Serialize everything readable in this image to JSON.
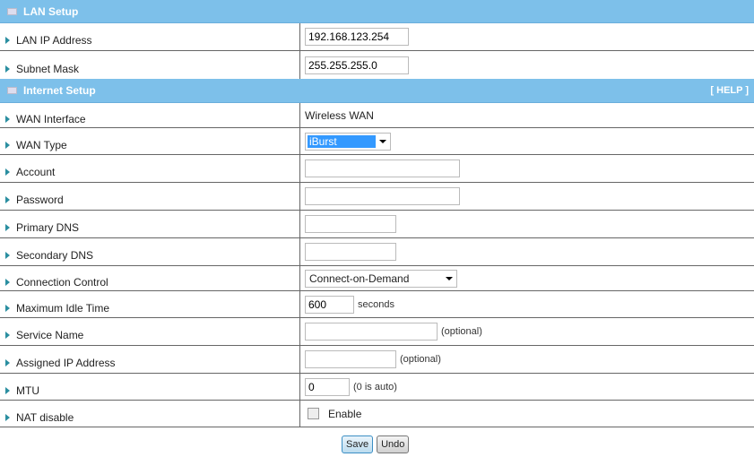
{
  "lan": {
    "title": "LAN Setup",
    "ip_label": "LAN IP Address",
    "ip_value": "192.168.123.254",
    "mask_label": "Subnet Mask",
    "mask_value": "255.255.255.0"
  },
  "internet": {
    "title": "Internet Setup",
    "help": "[ HELP ]",
    "wan_interface_label": "WAN Interface",
    "wan_interface_value": "Wireless WAN",
    "wan_type_label": "WAN Type",
    "wan_type_value": "iBurst",
    "account_label": "Account",
    "account_value": "",
    "password_label": "Password",
    "password_value": "",
    "pdns_label": "Primary DNS",
    "pdns_value": "",
    "sdns_label": "Secondary DNS",
    "sdns_value": "",
    "conn_label": "Connection Control",
    "conn_value": "Connect-on-Demand",
    "idle_label": "Maximum Idle Time",
    "idle_value": "600",
    "idle_unit": "seconds",
    "service_label": "Service Name",
    "service_value": "",
    "service_note": "(optional)",
    "assigned_label": "Assigned IP Address",
    "assigned_value": "",
    "assigned_note": "(optional)",
    "mtu_label": "MTU",
    "mtu_value": "0",
    "mtu_note": "(0 is auto)",
    "nat_label": "NAT disable",
    "nat_checkbox": "Enable",
    "nat_checked": false
  },
  "buttons": {
    "save": "Save",
    "undo": "Undo"
  }
}
